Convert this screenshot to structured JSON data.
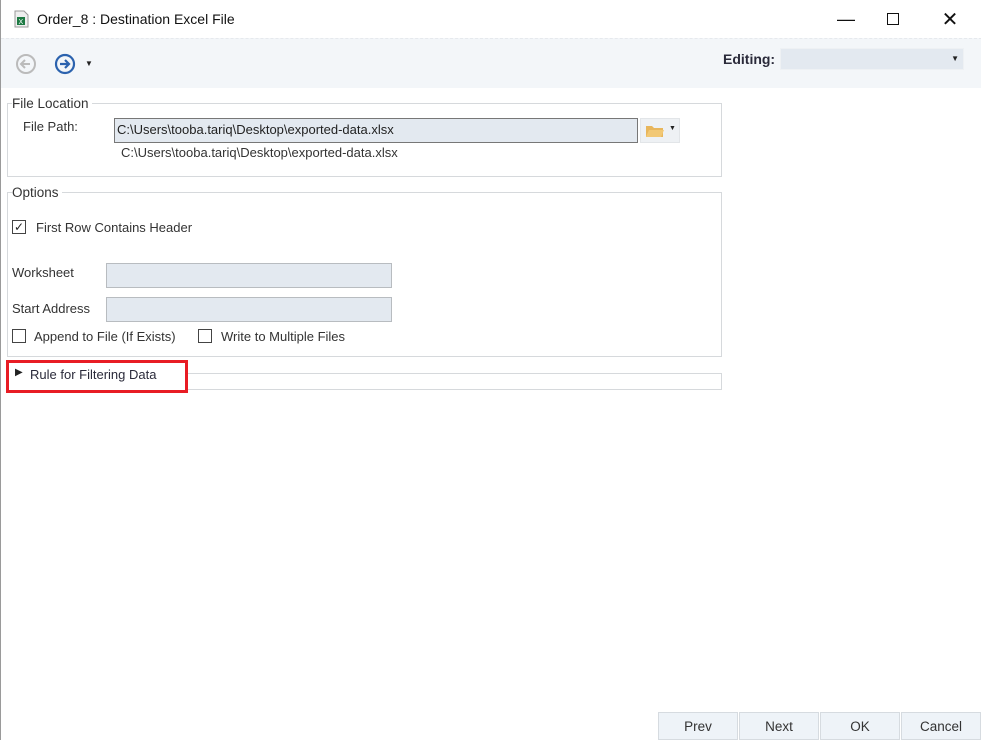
{
  "window": {
    "title": "Order_8 : Destination Excel File",
    "icon": "excel-file-icon"
  },
  "toolbar": {
    "back_icon": "back-arrow-icon",
    "forward_icon": "forward-arrow-icon",
    "editing_label": "Editing:",
    "editing_value": ""
  },
  "file_location": {
    "legend": "File Location",
    "file_path_label": "File Path:",
    "file_path_value": "C:\\Users\\tooba.tariq\\Desktop\\exported-data.xlsx",
    "file_path_hint": "C:\\Users\\tooba.tariq\\Desktop\\exported-data.xlsx"
  },
  "options": {
    "legend": "Options",
    "first_row_header": {
      "label": "First Row Contains Header",
      "checked": true
    },
    "worksheet_label": "Worksheet",
    "worksheet_value": "",
    "start_address_label": "Start Address",
    "start_address_value": "",
    "append": {
      "label": "Append to File (If Exists)",
      "checked": false
    },
    "multiple": {
      "label": "Write to Multiple Files",
      "checked": false
    }
  },
  "filter_rule": {
    "label": "Rule for Filtering Data",
    "highlight_color": "#e81c24"
  },
  "buttons": {
    "prev": "Prev",
    "next": "Next",
    "ok": "OK",
    "cancel": "Cancel"
  }
}
